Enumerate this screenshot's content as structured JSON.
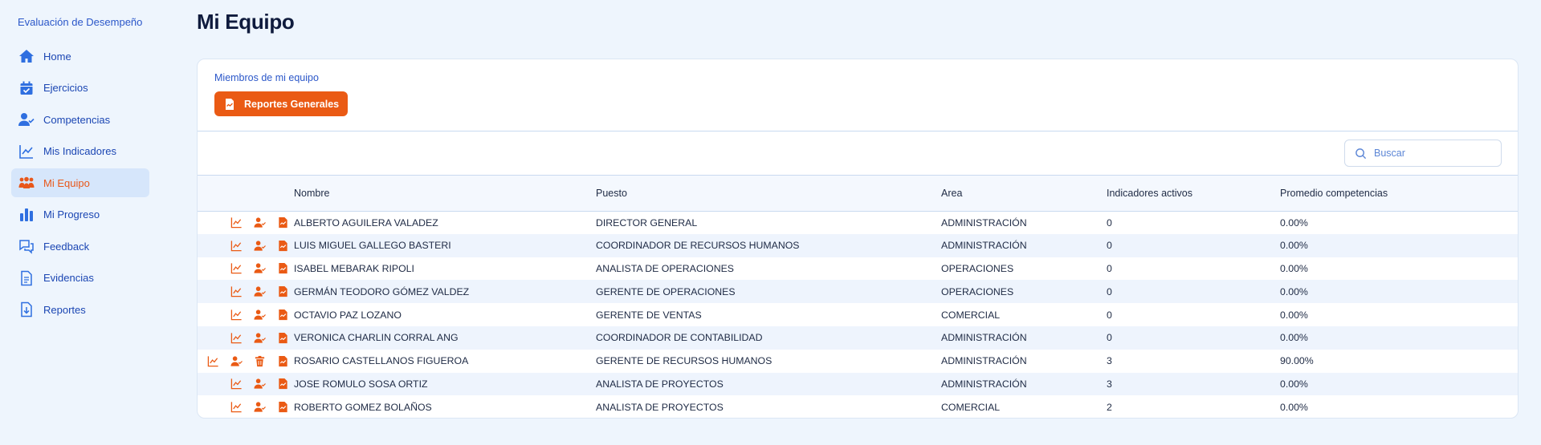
{
  "app": {
    "title": "Evaluación de Desempeño"
  },
  "nav": [
    {
      "label": "Home",
      "icon": "home-icon",
      "active": false
    },
    {
      "label": "Ejercicios",
      "icon": "calendar-check-icon",
      "active": false
    },
    {
      "label": "Competencias",
      "icon": "user-check-icon",
      "active": false
    },
    {
      "label": "Mis Indicadores",
      "icon": "chart-line-icon",
      "active": false
    },
    {
      "label": "Mi Equipo",
      "icon": "team-icon",
      "active": true
    },
    {
      "label": "Mi Progreso",
      "icon": "bar-chart-icon",
      "active": false
    },
    {
      "label": "Feedback",
      "icon": "chat-icon",
      "active": false
    },
    {
      "label": "Evidencias",
      "icon": "document-icon",
      "active": false
    },
    {
      "label": "Reportes",
      "icon": "download-doc-icon",
      "active": false
    }
  ],
  "page": {
    "title": "Mi Equipo"
  },
  "card": {
    "subtitle": "Miembros de mi equipo",
    "report_button": "Reportes Generales",
    "search_placeholder": "Buscar"
  },
  "table": {
    "headers": [
      "Nombre",
      "Puesto",
      "Area",
      "Indicadores activos",
      "Promedio competencias"
    ],
    "rows": [
      {
        "nombre": "ALBERTO AGUILERA VALADEZ",
        "puesto": "DIRECTOR GENERAL",
        "area": "ADMINISTRACIÓN",
        "indicadores": "0",
        "promedio": "0.00%",
        "actions": [
          "chart",
          "user-check",
          "report"
        ]
      },
      {
        "nombre": "LUIS MIGUEL GALLEGO BASTERI",
        "puesto": "COORDINADOR DE RECURSOS HUMANOS",
        "area": "ADMINISTRACIÓN",
        "indicadores": "0",
        "promedio": "0.00%",
        "actions": [
          "chart",
          "user-check",
          "report"
        ]
      },
      {
        "nombre": "ISABEL MEBARAK RIPOLI",
        "puesto": "ANALISTA DE OPERACIONES",
        "area": "OPERACIONES",
        "indicadores": "0",
        "promedio": "0.00%",
        "actions": [
          "chart",
          "user-check",
          "report"
        ]
      },
      {
        "nombre": "GERMÁN TEODORO GÓMEZ VALDEZ",
        "puesto": "GERENTE DE OPERACIONES",
        "area": "OPERACIONES",
        "indicadores": "0",
        "promedio": "0.00%",
        "actions": [
          "chart",
          "user-check",
          "report"
        ]
      },
      {
        "nombre": "OCTAVIO PAZ LOZANO",
        "puesto": "GERENTE DE VENTAS",
        "area": "COMERCIAL",
        "indicadores": "0",
        "promedio": "0.00%",
        "actions": [
          "chart",
          "user-check",
          "report"
        ]
      },
      {
        "nombre": "VERONICA CHARLIN CORRAL ANG",
        "puesto": "COORDINADOR DE CONTABILIDAD",
        "area": "ADMINISTRACIÓN",
        "indicadores": "0",
        "promedio": "0.00%",
        "actions": [
          "chart",
          "user-check",
          "report"
        ]
      },
      {
        "nombre": "ROSARIO CASTELLANOS FIGUEROA",
        "puesto": "GERENTE DE RECURSOS HUMANOS",
        "area": "ADMINISTRACIÓN",
        "indicadores": "3",
        "promedio": "90.00%",
        "actions": [
          "chart",
          "user-check",
          "trash",
          "report"
        ]
      },
      {
        "nombre": "JOSE ROMULO SOSA ORTIZ",
        "puesto": "ANALISTA DE PROYECTOS",
        "area": "ADMINISTRACIÓN",
        "indicadores": "3",
        "promedio": "0.00%",
        "actions": [
          "chart",
          "user-check",
          "report"
        ]
      },
      {
        "nombre": "ROBERTO GOMEZ BOLAÑOS",
        "puesto": "ANALISTA DE PROYECTOS",
        "area": "COMERCIAL",
        "indicadores": "2",
        "promedio": "0.00%",
        "actions": [
          "chart",
          "user-check",
          "report"
        ]
      }
    ]
  },
  "colors": {
    "accent": "#ea5a14",
    "nav_text": "#1b46b3",
    "nav_active_bg": "#d6e6fb",
    "background": "#eef5fd"
  }
}
